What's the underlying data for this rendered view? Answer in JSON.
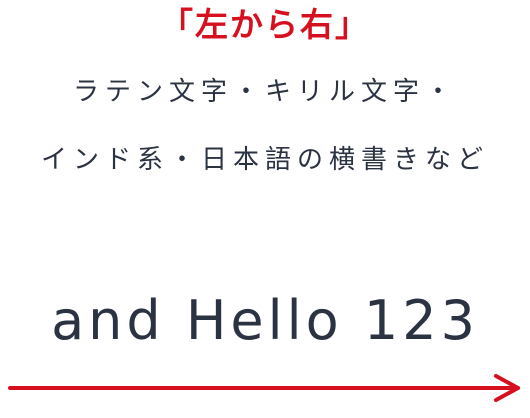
{
  "heading": {
    "text": "「左から右」",
    "color": "#d6101f"
  },
  "description": {
    "line1": "ラテン文字・キリル文字・",
    "line2": "インド系・日本語の横書きなど",
    "color": "#2b3342"
  },
  "sample": {
    "text": "and Hello 123"
  },
  "arrow": {
    "icon": "right-arrow-icon",
    "color": "#d6101f"
  }
}
